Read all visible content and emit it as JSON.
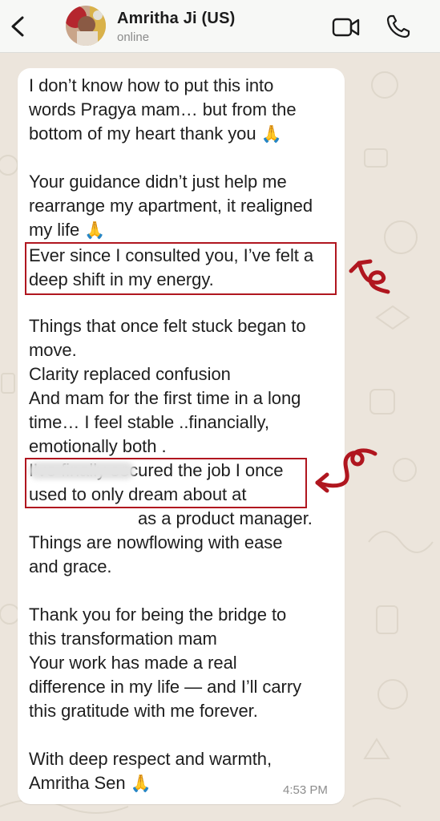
{
  "header": {
    "contact_name": "Amritha Ji (US)",
    "status": "online",
    "back_icon": "chevron-left-icon",
    "video_icon": "video-camera-icon",
    "call_icon": "phone-icon"
  },
  "message": {
    "lines": [
      "I don’t know how to put this into",
      "words Pragya mam… but from the",
      "bottom of my heart thank you",
      "Your guidance didn’t just help me",
      "rearrange my apartment, it realigned",
      "my life",
      "Ever since I consulted you, I’ve felt a",
      "deep shift in my energy.",
      "Things that once felt stuck began to",
      "move.",
      "Clarity replaced confusion",
      "And mam for the first time in a long",
      "time… I feel stable ..financially,",
      "emotionally both .",
      "I’ve finally secured the job I once",
      "used to only dream about at",
      "as a product manager.",
      "Things are nowflowing with ease",
      "and grace.",
      "Thank you for being the bridge to",
      "this transformation mam",
      "Your work has made a real",
      "difference in my life — and I’ll carry",
      "this gratitude with me forever.",
      "With deep respect and warmth,",
      "Amritha Sen"
    ],
    "emoji": "🙏",
    "time": "4:53 PM"
  },
  "colors": {
    "highlight": "#b0161f",
    "chat_background": "#ece5dc",
    "bubble": "#ffffff"
  }
}
